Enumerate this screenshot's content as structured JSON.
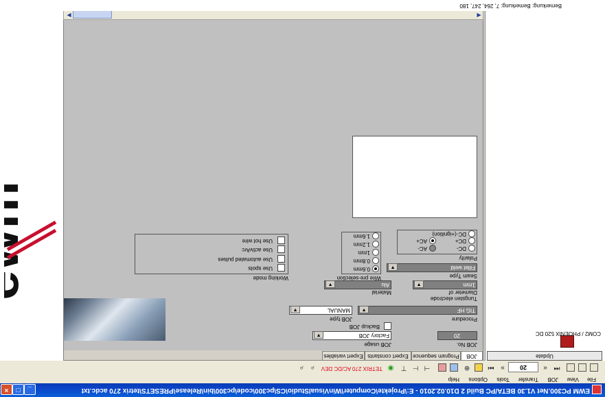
{
  "window": {
    "title": "EWM PC300.Net V1.30 BETA/PC Build 2 D10.02.2010 - E:\\Projekte\\Computer\\WinVisualStudio\\CS\\pc300\\code\\pc300\\bin\\Release\\PRESETS\\tetrix 270 acdc.txt"
  },
  "menu": [
    "File",
    "View",
    "JOB",
    "Transfer",
    "Tools",
    "Options",
    "Help"
  ],
  "toolbar": {
    "job_number": "20",
    "power_source": "TETRIX 270 AC/DC DEV"
  },
  "sidebar": {
    "update_label": "Update",
    "machine_label": "COM2 / PHOENIX 520 DC"
  },
  "tabs": [
    "JOB",
    "Program sequence",
    "Expert constants",
    "Expert variables"
  ],
  "job": {
    "job_no_label": "JOB No.",
    "job_no_value": "20",
    "job_usage_label": "JOB usage",
    "job_usage_value": "Factory JOB",
    "backup_label": "Backup JOB",
    "procedure_label": "Procedure",
    "procedure_value": "TIG HF",
    "job_type_label": "JOB type",
    "job_type_value": "MANUAL",
    "tungsten_label": "Tungsten electrode",
    "diameter_label": "Diameter of",
    "diameter_value": "1mm",
    "material_label": "Material",
    "material_value": "Alu",
    "seam_label": "Seam Type",
    "seam_value": "Fillet weld",
    "polarity_label": "Polarity",
    "polarity_options": [
      "DC-(+ignition)",
      "DC+",
      "AC+",
      "DC-",
      "AC-"
    ],
    "wire_label": "Wire pre-selection",
    "wire_options": [
      "1.6mm",
      "1.2mm",
      "1mm",
      "0.8mm",
      "0.6mm"
    ],
    "working_mode_label": "Working mode",
    "working_mode_options": [
      "Use hot wire",
      "Use activArc",
      "Use automated pulses",
      "Use spots"
    ]
  },
  "logo": {
    "text": "ewm"
  },
  "status": {
    "text": "Bemerkung: Bemerkung: 7, 264, 247, 180"
  }
}
